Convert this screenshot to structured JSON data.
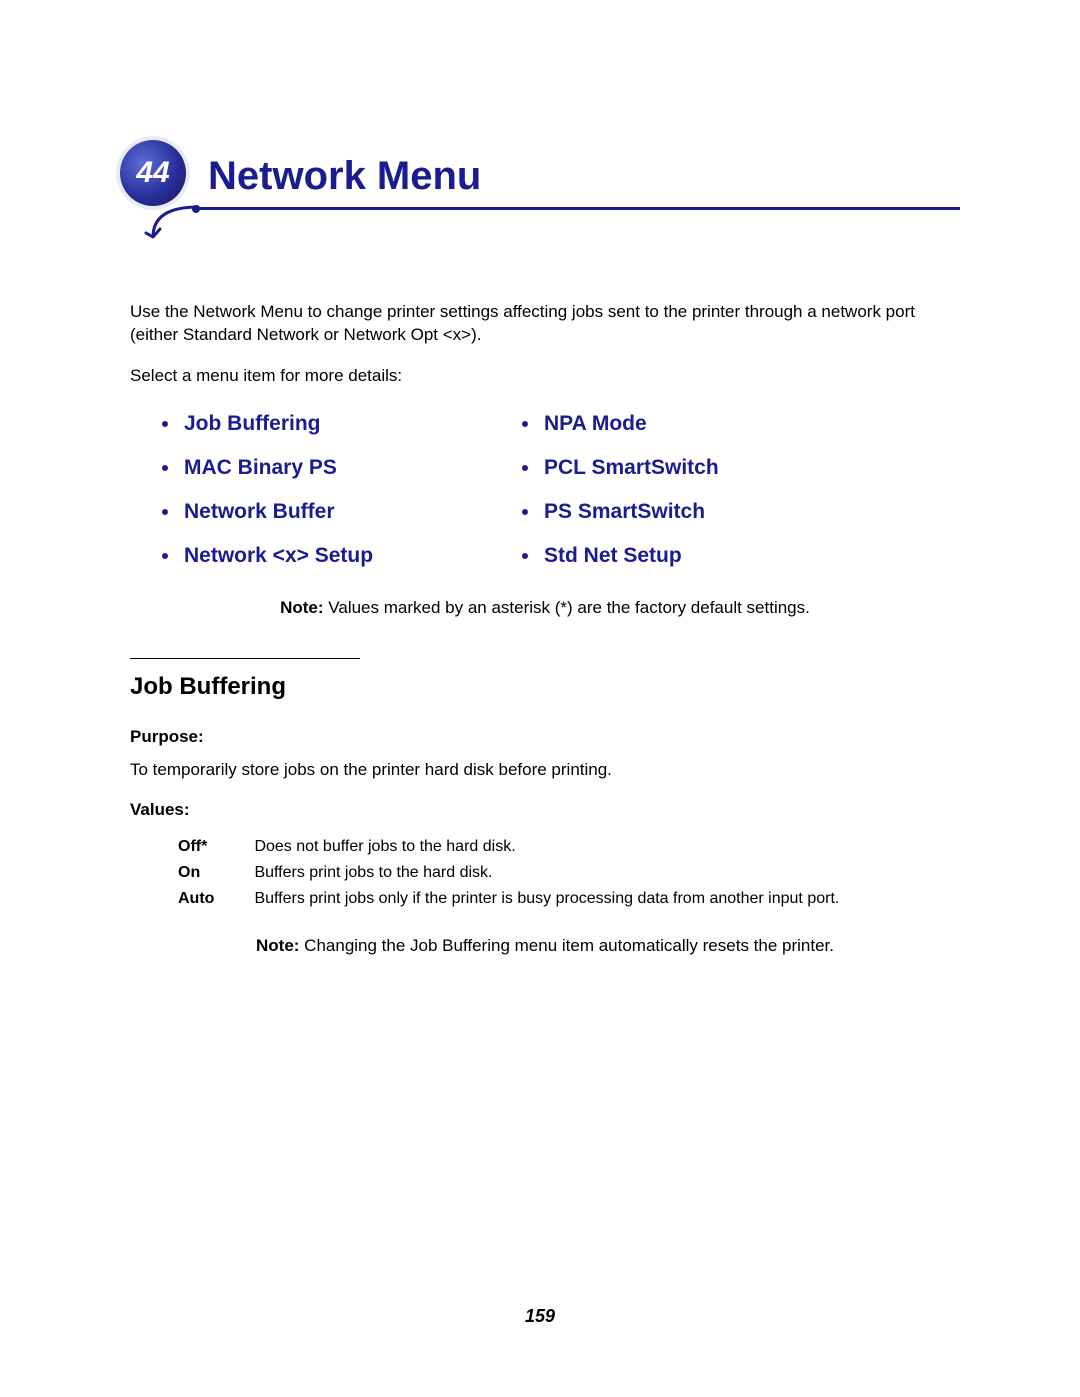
{
  "chapter": {
    "number": "44",
    "title": "Network Menu"
  },
  "intro": {
    "paragraph": "Use the Network Menu to change printer settings affecting jobs sent to the printer through a network port (either Standard Network or Network Opt <x>).",
    "select_line": "Select a menu item for more details:"
  },
  "menu": {
    "col1": [
      "Job Buffering",
      "MAC Binary PS",
      "Network Buffer",
      "Network <x> Setup"
    ],
    "col2": [
      "NPA Mode",
      "PCL SmartSwitch",
      "PS SmartSwitch",
      "Std Net Setup"
    ]
  },
  "defaults_note": {
    "label": "Note:",
    "text": " Values marked by an asterisk (*) are the factory default settings."
  },
  "section": {
    "heading": "Job Buffering",
    "purpose_label": "Purpose:",
    "purpose_text": "To temporarily store jobs on the printer hard disk before printing.",
    "values_label": "Values:",
    "values": [
      {
        "key": "Off*",
        "desc": "Does not buffer jobs to the hard disk."
      },
      {
        "key": "On",
        "desc": "Buffers print jobs to the hard disk."
      },
      {
        "key": "Auto",
        "desc": "Buffers print jobs only if the printer is busy processing data from another input port."
      }
    ],
    "note_label": "Note:",
    "note_text": " Changing the Job Buffering menu item automatically resets the printer."
  },
  "page_number": "159"
}
